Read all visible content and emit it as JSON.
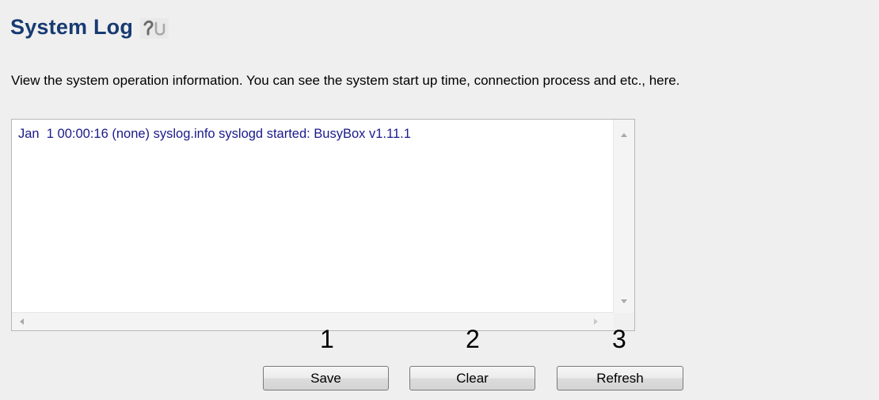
{
  "header": {
    "title": "System Log",
    "help_icon": "help-icon"
  },
  "description": "View the system operation information. You can see the system start up time, connection process and etc., here.",
  "log": {
    "text": "Jan  1 00:00:16 (none) syslog.info syslogd started: BusyBox v1.11.1"
  },
  "annotations": {
    "n1": "1",
    "n2": "2",
    "n3": "3"
  },
  "buttons": {
    "save": "Save",
    "clear": "Clear",
    "refresh": "Refresh"
  },
  "colors": {
    "title": "#173a72",
    "log_text": "#1a1a8c",
    "background": "#efefef"
  }
}
